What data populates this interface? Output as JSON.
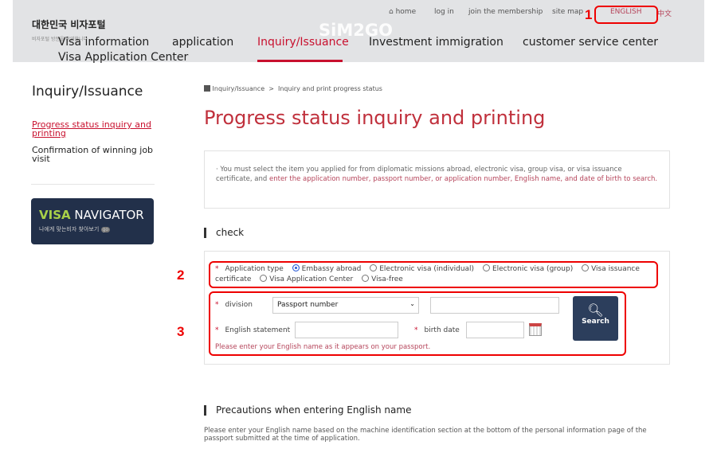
{
  "header": {
    "logo_title": "대한민국 비자포털",
    "logo_sub": "비자포털 방문을 환영합니다",
    "watermark": "SiM2GO",
    "util": [
      {
        "label": "home",
        "icon": "home-icon"
      },
      {
        "label": "log in"
      },
      {
        "label": "join the membership"
      },
      {
        "label": "site map"
      },
      {
        "label": "ENGLISH"
      },
      {
        "label": "中文"
      }
    ],
    "nav": [
      "Visa information",
      "application",
      "Inquiry/Issuance",
      "Investment immigration",
      "customer service center",
      "Visa Application Center"
    ],
    "active_nav": "Inquiry/Issuance"
  },
  "callouts": [
    "1",
    "2",
    "3"
  ],
  "sidebar": {
    "title": "Inquiry/Issuance",
    "items": [
      {
        "label": "Progress status inquiry and printing",
        "active": true
      },
      {
        "label": "Confirmation of winning job visit",
        "active": false
      }
    ],
    "banner": {
      "title_a": "VISA",
      "title_b": "NAVIGATOR",
      "sub": "나에게 맞는비자 찾아보기",
      "go": "go"
    }
  },
  "breadcrumb": [
    "Inquiry/Issuance",
    "Inquiry and print progress status"
  ],
  "page_title": "Progress status inquiry and printing",
  "notice": {
    "text_a": "· You must select the item you applied for from diplomatic missions abroad, electronic visa, group visa, or visa issuance certificate, and ",
    "text_b": "enter the application number, passport number, or application number, English name, and date of birth to search."
  },
  "check": {
    "heading": "check",
    "app_type_label": "Application type",
    "options": [
      {
        "label": "Embassy abroad",
        "selected": true
      },
      {
        "label": "Electronic visa (individual)"
      },
      {
        "label": "Electronic visa (group)"
      },
      {
        "label": "Visa issuance certificate"
      },
      {
        "label": "Visa Application Center"
      },
      {
        "label": "Visa-free"
      }
    ],
    "division_label": "division",
    "division_value": "Passport number",
    "division_input": "",
    "english_label": "English statement",
    "birth_label": "birth date",
    "hint": "Please enter your English name as it appears on your passport.",
    "search_label": "Search"
  },
  "precautions": {
    "heading": "Precautions when entering English name",
    "text": "Please enter your English name based on the machine identification section at the bottom of the personal information page of the passport submitted at the time of application."
  },
  "colors": {
    "accent": "#c8102e",
    "callout": "#ee0000",
    "search_button": "#2c3e5c"
  }
}
